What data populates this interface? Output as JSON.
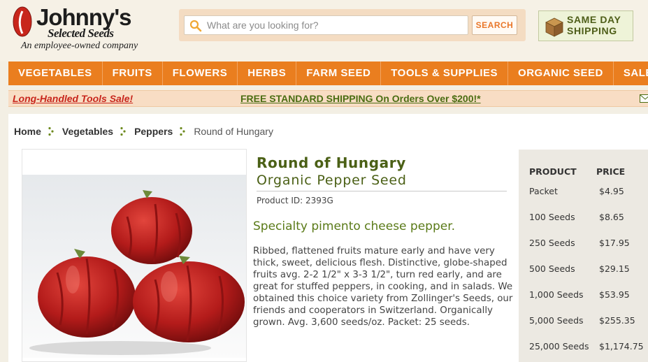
{
  "header": {
    "logo_name": "Johnny's",
    "logo_sub": "Selected Seeds",
    "logo_tagline": "An employee-owned company",
    "search_placeholder": "What are you looking for?",
    "search_button": "SEARCH",
    "same_day_line1": "SAME DAY",
    "same_day_line2": "SHIPPING"
  },
  "nav": {
    "items": [
      "VEGETABLES",
      "FRUITS",
      "FLOWERS",
      "HERBS",
      "FARM SEED",
      "TOOLS & SUPPLIES",
      "ORGANIC SEED",
      "SALE"
    ]
  },
  "promo": {
    "sale": "Long-Handled Tools Sale!",
    "shipping": "FREE STANDARD SHIPPING On Orders Over $200!*"
  },
  "breadcrumb": [
    "Home",
    "Vegetables",
    "Peppers",
    "Round of Hungary"
  ],
  "product": {
    "title": "Round of Hungary",
    "subtitle": "Organic Pepper Seed",
    "product_id": "Product ID: 2393G",
    "headline": "Specialty pimento cheese pepper.",
    "description": "Ribbed, flattened fruits mature early and have very thick, sweet, delicious flesh. Distinctive, globe-shaped fruits avg. 2-2 1/2\" x 3-3 1/2\", turn red early, and are great for stuffed peppers, in cooking, and in salads. We obtained this choice variety from Zollinger's Seeds, our friends and cooperators in Switzerland. Organically grown. Avg. 3,600 seeds/oz. Packet: 25 seeds."
  },
  "pricing": {
    "product_header": "PRODUCT",
    "price_header": "PRICE",
    "rows": [
      {
        "size": "Packet",
        "price": "$4.95"
      },
      {
        "size": "100 Seeds",
        "price": "$8.65"
      },
      {
        "size": "250 Seeds",
        "price": "$17.95"
      },
      {
        "size": "500 Seeds",
        "price": "$29.15"
      },
      {
        "size": "1,000 Seeds",
        "price": "$53.95"
      },
      {
        "size": "5,000 Seeds",
        "price": "$255.35"
      },
      {
        "size": "25,000 Seeds",
        "price": "$1,174.75"
      }
    ]
  },
  "colors": {
    "nav_orange": "#ea7e1f",
    "brand_green": "#4b6016",
    "sale_red": "#c8261c"
  },
  "icons": [
    "johnnys-logo-icon",
    "search-icon",
    "box-icon",
    "crumb-separator-icon",
    "mail-icon"
  ]
}
